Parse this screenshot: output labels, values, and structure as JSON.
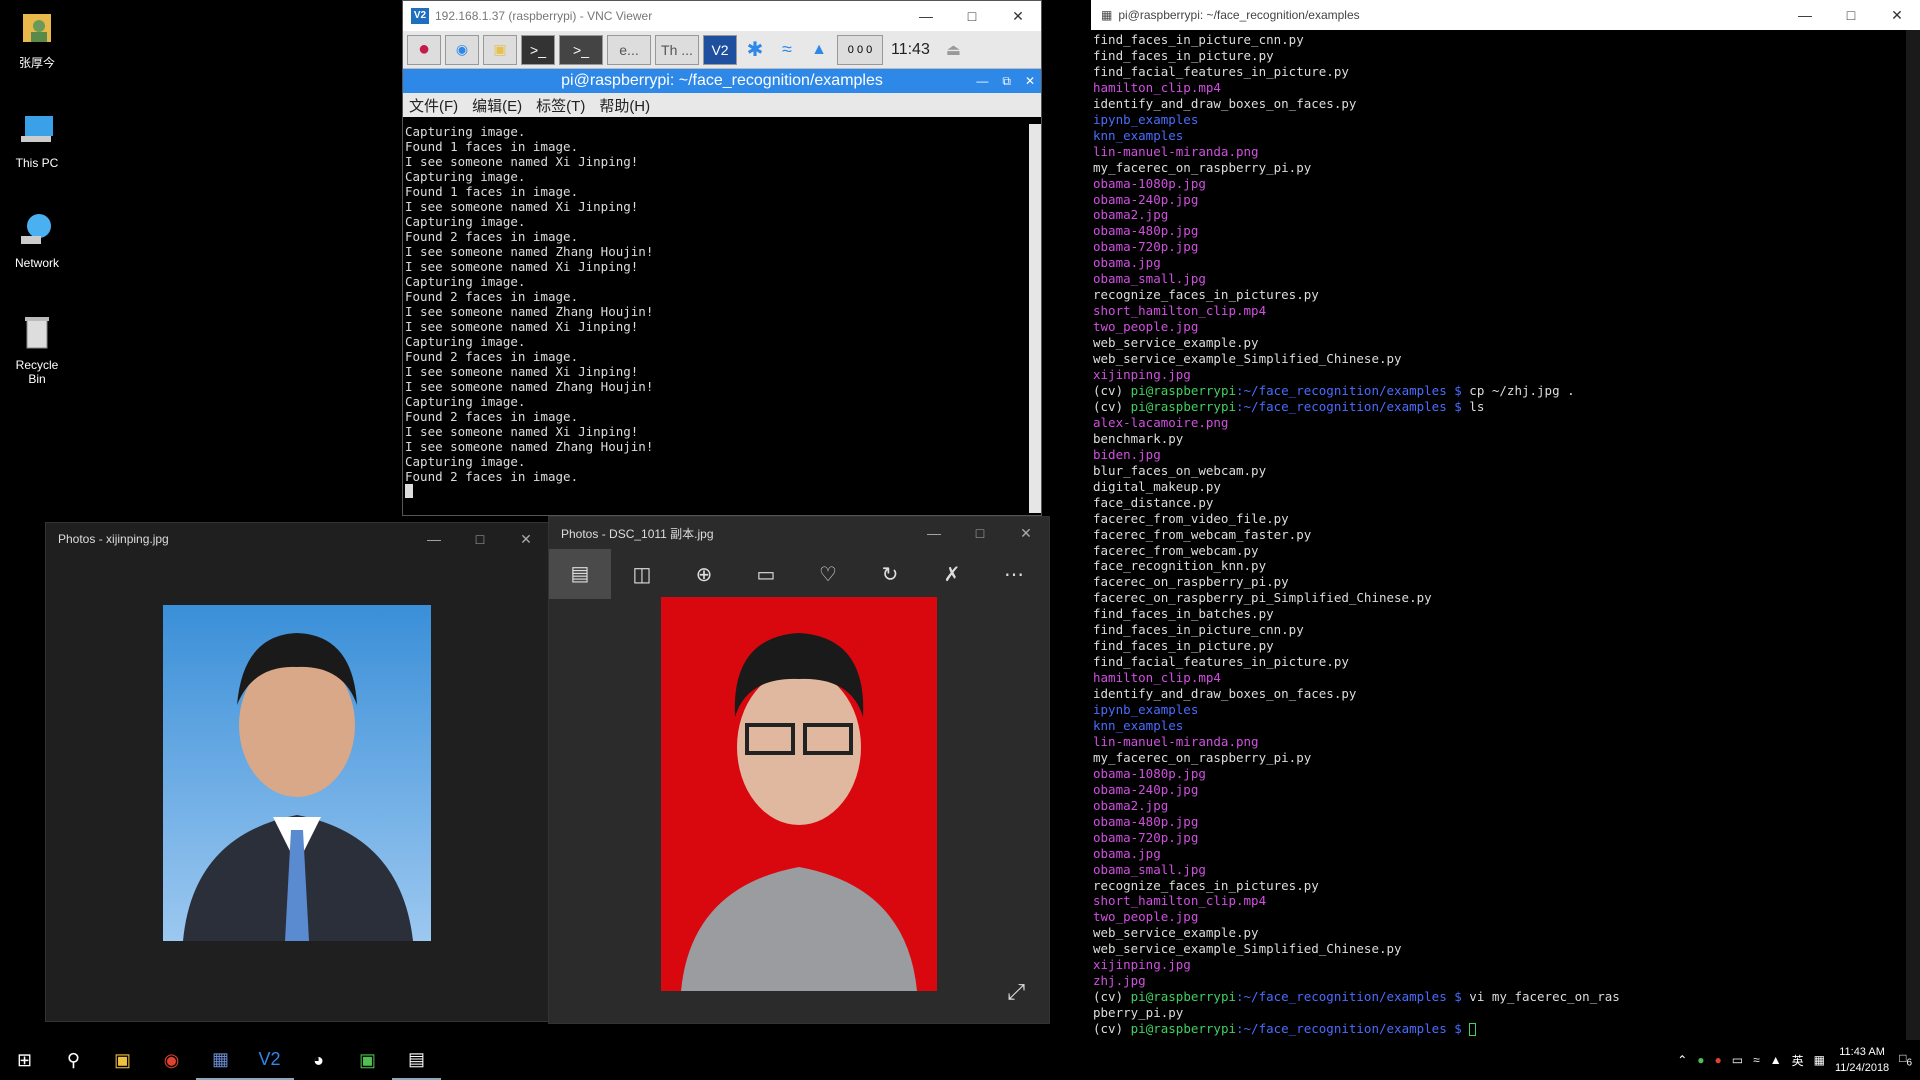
{
  "desktop": {
    "icons": [
      {
        "label": "张厚今",
        "icon": "user-folder-icon"
      },
      {
        "label": "This PC",
        "icon": "computer-icon"
      },
      {
        "label": "Network",
        "icon": "network-icon"
      },
      {
        "label": "Recycle Bin",
        "icon": "recycle-bin-icon"
      }
    ]
  },
  "vnc": {
    "title": "192.168.1.37 (raspberrypi) - VNC Viewer",
    "logo": "V2",
    "pi_clock": "11:43",
    "pi_task_label": "e...",
    "pi_task_label2": "Th ...",
    "pi_volume_label": "0 0 0",
    "terminal_title": "pi@raspberrypi: ~/face_recognition/examples",
    "menu": [
      "文件(F)",
      "编辑(E)",
      "标签(T)",
      "帮助(H)"
    ],
    "lines": [
      "Capturing image.",
      "Found 1 faces in image.",
      "I see someone named Xi Jinping!",
      "Capturing image.",
      "Found 1 faces in image.",
      "I see someone named Xi Jinping!",
      "Capturing image.",
      "Found 2 faces in image.",
      "I see someone named Zhang Houjin!",
      "I see someone named Xi Jinping!",
      "Capturing image.",
      "Found 2 faces in image.",
      "I see someone named Zhang Houjin!",
      "I see someone named Xi Jinping!",
      "Capturing image.",
      "Found 2 faces in image.",
      "I see someone named Xi Jinping!",
      "I see someone named Zhang Houjin!",
      "Capturing image.",
      "Found 2 faces in image.",
      "I see someone named Xi Jinping!",
      "I see someone named Zhang Houjin!",
      "Capturing image.",
      "Found 2 faces in image."
    ]
  },
  "right_terminal": {
    "title": "pi@raspberrypi: ~/face_recognition/examples",
    "prompt_env": "(cv) ",
    "prompt_host": "pi@raspberrypi",
    "prompt_path": ":~/face_recognition/examples $ ",
    "lines": [
      {
        "t": "find_faces_in_picture_cnn.py",
        "c": ""
      },
      {
        "t": "find_faces_in_picture.py",
        "c": ""
      },
      {
        "t": "find_facial_features_in_picture.py",
        "c": ""
      },
      {
        "t": "hamilton_clip.mp4",
        "c": "mag"
      },
      {
        "t": "identify_and_draw_boxes_on_faces.py",
        "c": ""
      },
      {
        "t": "ipynb_examples",
        "c": "blu"
      },
      {
        "t": "knn_examples",
        "c": "blu"
      },
      {
        "t": "lin-manuel-miranda.png",
        "c": "mag"
      },
      {
        "t": "my_facerec_on_raspberry_pi.py",
        "c": ""
      },
      {
        "t": "obama-1080p.jpg",
        "c": "mag"
      },
      {
        "t": "obama-240p.jpg",
        "c": "mag"
      },
      {
        "t": "obama2.jpg",
        "c": "mag"
      },
      {
        "t": "obama-480p.jpg",
        "c": "mag"
      },
      {
        "t": "obama-720p.jpg",
        "c": "mag"
      },
      {
        "t": "obama.jpg",
        "c": "mag"
      },
      {
        "t": "obama_small.jpg",
        "c": "mag"
      },
      {
        "t": "recognize_faces_in_pictures.py",
        "c": ""
      },
      {
        "t": "short_hamilton_clip.mp4",
        "c": "mag"
      },
      {
        "t": "two_people.jpg",
        "c": "mag"
      },
      {
        "t": "web_service_example.py",
        "c": ""
      },
      {
        "t": "web_service_example_Simplified_Chinese.py",
        "c": ""
      },
      {
        "t": "xijinping.jpg",
        "c": "mag"
      },
      {
        "t": "cp ~/zhj.jpg .",
        "c": "prompt"
      },
      {
        "t": "ls",
        "c": "prompt"
      },
      {
        "t": "alex-lacamoire.png",
        "c": "mag"
      },
      {
        "t": "benchmark.py",
        "c": ""
      },
      {
        "t": "biden.jpg",
        "c": "mag"
      },
      {
        "t": "blur_faces_on_webcam.py",
        "c": ""
      },
      {
        "t": "digital_makeup.py",
        "c": ""
      },
      {
        "t": "face_distance.py",
        "c": ""
      },
      {
        "t": "facerec_from_video_file.py",
        "c": ""
      },
      {
        "t": "facerec_from_webcam_faster.py",
        "c": ""
      },
      {
        "t": "facerec_from_webcam.py",
        "c": ""
      },
      {
        "t": "face_recognition_knn.py",
        "c": ""
      },
      {
        "t": "facerec_on_raspberry_pi.py",
        "c": ""
      },
      {
        "t": "facerec_on_raspberry_pi_Simplified_Chinese.py",
        "c": ""
      },
      {
        "t": "find_faces_in_batches.py",
        "c": ""
      },
      {
        "t": "find_faces_in_picture_cnn.py",
        "c": ""
      },
      {
        "t": "find_faces_in_picture.py",
        "c": ""
      },
      {
        "t": "find_facial_features_in_picture.py",
        "c": ""
      },
      {
        "t": "hamilton_clip.mp4",
        "c": "mag"
      },
      {
        "t": "identify_and_draw_boxes_on_faces.py",
        "c": ""
      },
      {
        "t": "ipynb_examples",
        "c": "blu"
      },
      {
        "t": "knn_examples",
        "c": "blu"
      },
      {
        "t": "lin-manuel-miranda.png",
        "c": "mag"
      },
      {
        "t": "my_facerec_on_raspberry_pi.py",
        "c": ""
      },
      {
        "t": "obama-1080p.jpg",
        "c": "mag"
      },
      {
        "t": "obama-240p.jpg",
        "c": "mag"
      },
      {
        "t": "obama2.jpg",
        "c": "mag"
      },
      {
        "t": "obama-480p.jpg",
        "c": "mag"
      },
      {
        "t": "obama-720p.jpg",
        "c": "mag"
      },
      {
        "t": "obama.jpg",
        "c": "mag"
      },
      {
        "t": "obama_small.jpg",
        "c": "mag"
      },
      {
        "t": "recognize_faces_in_pictures.py",
        "c": ""
      },
      {
        "t": "short_hamilton_clip.mp4",
        "c": "mag"
      },
      {
        "t": "two_people.jpg",
        "c": "mag"
      },
      {
        "t": "web_service_example.py",
        "c": ""
      },
      {
        "t": "web_service_example_Simplified_Chinese.py",
        "c": ""
      },
      {
        "t": "xijinping.jpg",
        "c": "mag"
      },
      {
        "t": "zhj.jpg",
        "c": "mag"
      },
      {
        "t": "vi my_facerec_on_ras",
        "c": "prompt"
      },
      {
        "t": "pberry_pi.py",
        "c": ""
      },
      {
        "t": "",
        "c": "prompt"
      }
    ]
  },
  "photo1": {
    "title": "Photos - xijinping.jpg"
  },
  "photo2": {
    "title": "Photos - DSC_1011 副本.jpg"
  },
  "taskbar": {
    "time": "11:43 AM",
    "date": "11/24/2018",
    "ime": "英",
    "notifications": "6"
  },
  "colors": {
    "pi_blue": "#2e88e8",
    "magenta": "#d050e0",
    "dir_blue": "#4a6cff",
    "prompt_green": "#40d060"
  }
}
